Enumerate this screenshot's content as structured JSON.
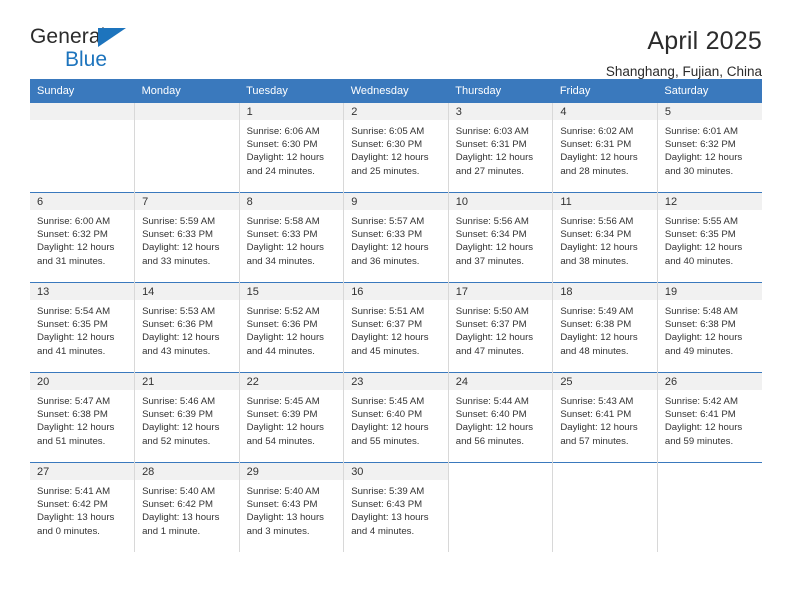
{
  "brand": {
    "name_top": "General",
    "name_bottom": "Blue",
    "triangle_color": "#1d74bd"
  },
  "header": {
    "title": "April 2025",
    "location": "Shanghang, Fujian, China"
  },
  "theme": {
    "header_blue": "#3a79bd",
    "daynum_gray": "#f1f1f1",
    "text": "#333333"
  },
  "weekday_headers": [
    "Sunday",
    "Monday",
    "Tuesday",
    "Wednesday",
    "Thursday",
    "Friday",
    "Saturday"
  ],
  "weeks": [
    [
      {
        "day": "",
        "lines": []
      },
      {
        "day": "",
        "lines": []
      },
      {
        "day": "1",
        "lines": [
          "Sunrise: 6:06 AM",
          "Sunset: 6:30 PM",
          "Daylight: 12 hours",
          "and 24 minutes."
        ]
      },
      {
        "day": "2",
        "lines": [
          "Sunrise: 6:05 AM",
          "Sunset: 6:30 PM",
          "Daylight: 12 hours",
          "and 25 minutes."
        ]
      },
      {
        "day": "3",
        "lines": [
          "Sunrise: 6:03 AM",
          "Sunset: 6:31 PM",
          "Daylight: 12 hours",
          "and 27 minutes."
        ]
      },
      {
        "day": "4",
        "lines": [
          "Sunrise: 6:02 AM",
          "Sunset: 6:31 PM",
          "Daylight: 12 hours",
          "and 28 minutes."
        ]
      },
      {
        "day": "5",
        "lines": [
          "Sunrise: 6:01 AM",
          "Sunset: 6:32 PM",
          "Daylight: 12 hours",
          "and 30 minutes."
        ]
      }
    ],
    [
      {
        "day": "6",
        "lines": [
          "Sunrise: 6:00 AM",
          "Sunset: 6:32 PM",
          "Daylight: 12 hours",
          "and 31 minutes."
        ]
      },
      {
        "day": "7",
        "lines": [
          "Sunrise: 5:59 AM",
          "Sunset: 6:33 PM",
          "Daylight: 12 hours",
          "and 33 minutes."
        ]
      },
      {
        "day": "8",
        "lines": [
          "Sunrise: 5:58 AM",
          "Sunset: 6:33 PM",
          "Daylight: 12 hours",
          "and 34 minutes."
        ]
      },
      {
        "day": "9",
        "lines": [
          "Sunrise: 5:57 AM",
          "Sunset: 6:33 PM",
          "Daylight: 12 hours",
          "and 36 minutes."
        ]
      },
      {
        "day": "10",
        "lines": [
          "Sunrise: 5:56 AM",
          "Sunset: 6:34 PM",
          "Daylight: 12 hours",
          "and 37 minutes."
        ]
      },
      {
        "day": "11",
        "lines": [
          "Sunrise: 5:56 AM",
          "Sunset: 6:34 PM",
          "Daylight: 12 hours",
          "and 38 minutes."
        ]
      },
      {
        "day": "12",
        "lines": [
          "Sunrise: 5:55 AM",
          "Sunset: 6:35 PM",
          "Daylight: 12 hours",
          "and 40 minutes."
        ]
      }
    ],
    [
      {
        "day": "13",
        "lines": [
          "Sunrise: 5:54 AM",
          "Sunset: 6:35 PM",
          "Daylight: 12 hours",
          "and 41 minutes."
        ]
      },
      {
        "day": "14",
        "lines": [
          "Sunrise: 5:53 AM",
          "Sunset: 6:36 PM",
          "Daylight: 12 hours",
          "and 43 minutes."
        ]
      },
      {
        "day": "15",
        "lines": [
          "Sunrise: 5:52 AM",
          "Sunset: 6:36 PM",
          "Daylight: 12 hours",
          "and 44 minutes."
        ]
      },
      {
        "day": "16",
        "lines": [
          "Sunrise: 5:51 AM",
          "Sunset: 6:37 PM",
          "Daylight: 12 hours",
          "and 45 minutes."
        ]
      },
      {
        "day": "17",
        "lines": [
          "Sunrise: 5:50 AM",
          "Sunset: 6:37 PM",
          "Daylight: 12 hours",
          "and 47 minutes."
        ]
      },
      {
        "day": "18",
        "lines": [
          "Sunrise: 5:49 AM",
          "Sunset: 6:38 PM",
          "Daylight: 12 hours",
          "and 48 minutes."
        ]
      },
      {
        "day": "19",
        "lines": [
          "Sunrise: 5:48 AM",
          "Sunset: 6:38 PM",
          "Daylight: 12 hours",
          "and 49 minutes."
        ]
      }
    ],
    [
      {
        "day": "20",
        "lines": [
          "Sunrise: 5:47 AM",
          "Sunset: 6:38 PM",
          "Daylight: 12 hours",
          "and 51 minutes."
        ]
      },
      {
        "day": "21",
        "lines": [
          "Sunrise: 5:46 AM",
          "Sunset: 6:39 PM",
          "Daylight: 12 hours",
          "and 52 minutes."
        ]
      },
      {
        "day": "22",
        "lines": [
          "Sunrise: 5:45 AM",
          "Sunset: 6:39 PM",
          "Daylight: 12 hours",
          "and 54 minutes."
        ]
      },
      {
        "day": "23",
        "lines": [
          "Sunrise: 5:45 AM",
          "Sunset: 6:40 PM",
          "Daylight: 12 hours",
          "and 55 minutes."
        ]
      },
      {
        "day": "24",
        "lines": [
          "Sunrise: 5:44 AM",
          "Sunset: 6:40 PM",
          "Daylight: 12 hours",
          "and 56 minutes."
        ]
      },
      {
        "day": "25",
        "lines": [
          "Sunrise: 5:43 AM",
          "Sunset: 6:41 PM",
          "Daylight: 12 hours",
          "and 57 minutes."
        ]
      },
      {
        "day": "26",
        "lines": [
          "Sunrise: 5:42 AM",
          "Sunset: 6:41 PM",
          "Daylight: 12 hours",
          "and 59 minutes."
        ]
      }
    ],
    [
      {
        "day": "27",
        "lines": [
          "Sunrise: 5:41 AM",
          "Sunset: 6:42 PM",
          "Daylight: 13 hours",
          "and 0 minutes."
        ]
      },
      {
        "day": "28",
        "lines": [
          "Sunrise: 5:40 AM",
          "Sunset: 6:42 PM",
          "Daylight: 13 hours",
          "and 1 minute."
        ]
      },
      {
        "day": "29",
        "lines": [
          "Sunrise: 5:40 AM",
          "Sunset: 6:43 PM",
          "Daylight: 13 hours",
          "and 3 minutes."
        ]
      },
      {
        "day": "30",
        "lines": [
          "Sunrise: 5:39 AM",
          "Sunset: 6:43 PM",
          "Daylight: 13 hours",
          "and 4 minutes."
        ]
      },
      {
        "day": "",
        "lines": []
      },
      {
        "day": "",
        "lines": []
      },
      {
        "day": "",
        "lines": []
      }
    ]
  ]
}
